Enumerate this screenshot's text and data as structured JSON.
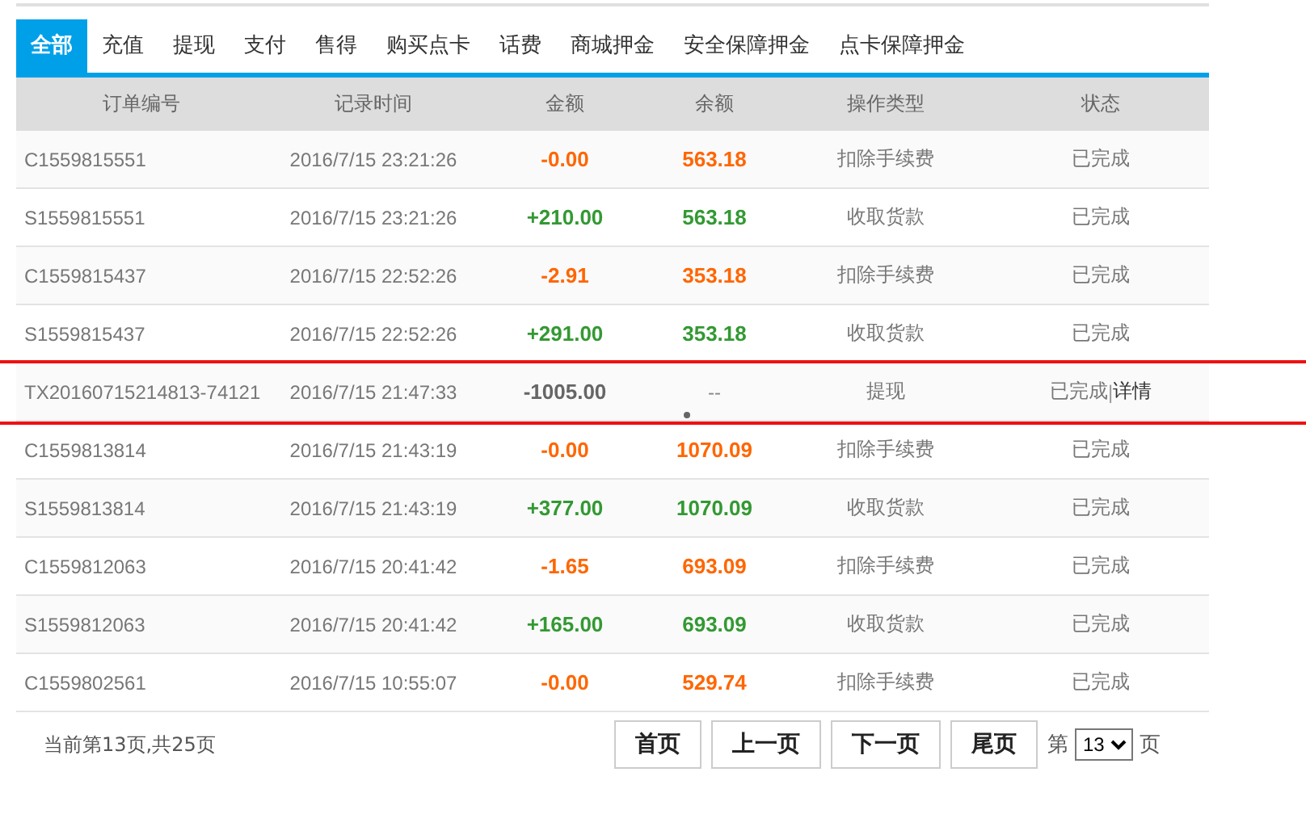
{
  "tabs": [
    {
      "label": "全部",
      "selected": true
    },
    {
      "label": "充值",
      "selected": false
    },
    {
      "label": "提现",
      "selected": false
    },
    {
      "label": "支付",
      "selected": false
    },
    {
      "label": "售得",
      "selected": false
    },
    {
      "label": "购买点卡",
      "selected": false
    },
    {
      "label": "话费",
      "selected": false
    },
    {
      "label": "商城押金",
      "selected": false
    },
    {
      "label": "安全保障押金",
      "selected": false
    },
    {
      "label": "点卡保障押金",
      "selected": false
    }
  ],
  "table": {
    "columns": [
      "订单编号",
      "记录时间",
      "金额",
      "余额",
      "操作类型",
      "状态"
    ],
    "rows": [
      {
        "kind": "debit",
        "order": "C1559815551",
        "time": "2016/7/15 23:21:26",
        "amount": "-0.00",
        "balance": "563.18",
        "type": "扣除手续费",
        "status": "已完成"
      },
      {
        "kind": "credit",
        "order": "S1559815551",
        "time": "2016/7/15 23:21:26",
        "amount": "+210.00",
        "balance": "563.18",
        "type": "收取货款",
        "status": "已完成"
      },
      {
        "kind": "debit",
        "order": "C1559815437",
        "time": "2016/7/15 22:52:26",
        "amount": "-2.91",
        "balance": "353.18",
        "type": "扣除手续费",
        "status": "已完成"
      },
      {
        "kind": "credit",
        "order": "S1559815437",
        "time": "2016/7/15 22:52:26",
        "amount": "+291.00",
        "balance": "353.18",
        "type": "收取货款",
        "status": "已完成"
      },
      {
        "kind": "withdraw",
        "order": "TX20160715214813-74121",
        "time": "2016/7/15 21:47:33",
        "amount": "-1005.00",
        "balance": "--",
        "type": "提现",
        "status": "已完成",
        "separator": "|",
        "link": "详情"
      },
      {
        "kind": "debit",
        "order": "C1559813814",
        "time": "2016/7/15 21:43:19",
        "amount": "-0.00",
        "balance": "1070.09",
        "type": "扣除手续费",
        "status": "已完成"
      },
      {
        "kind": "credit",
        "order": "S1559813814",
        "time": "2016/7/15 21:43:19",
        "amount": "+377.00",
        "balance": "1070.09",
        "type": "收取货款",
        "status": "已完成"
      },
      {
        "kind": "debit",
        "order": "C1559812063",
        "time": "2016/7/15 20:41:42",
        "amount": "-1.65",
        "balance": "693.09",
        "type": "扣除手续费",
        "status": "已完成"
      },
      {
        "kind": "credit",
        "order": "S1559812063",
        "time": "2016/7/15 20:41:42",
        "amount": "+165.00",
        "balance": "693.09",
        "type": "收取货款",
        "status": "已完成"
      },
      {
        "kind": "debit",
        "order": "C1559802561",
        "time": "2016/7/15 10:55:07",
        "amount": "-0.00",
        "balance": "529.74",
        "type": "扣除手续费",
        "status": "已完成"
      }
    ]
  },
  "pager": {
    "summary": "当前第13页,共25页",
    "buttons": [
      "首页",
      "上一页",
      "下一页",
      "尾页"
    ],
    "prefix": "第",
    "page": "13",
    "suffix": "页"
  }
}
